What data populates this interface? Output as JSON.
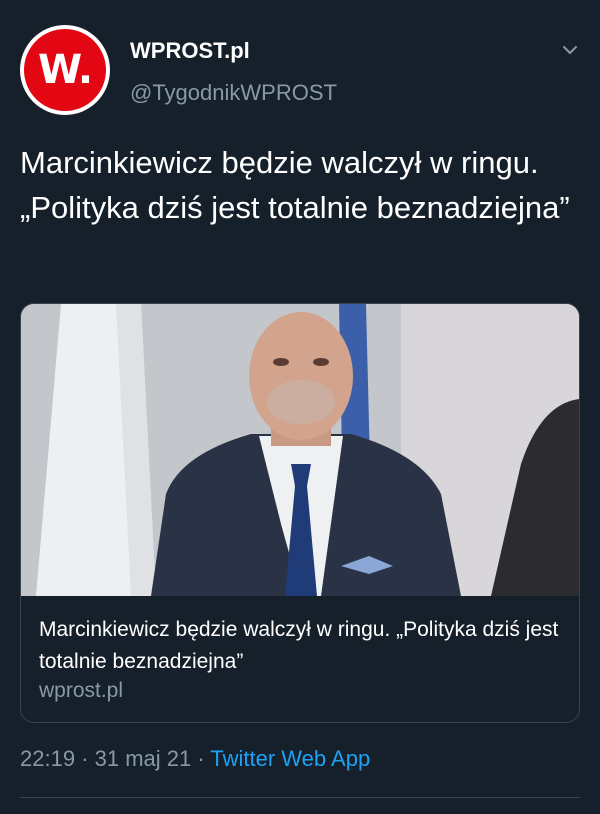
{
  "account": {
    "name": "WPROST.pl",
    "handle": "@TygodnikWPROST",
    "avatar_letter": "W."
  },
  "tweet": {
    "text": "Marcinkiewicz będzie walczył w ringu. „Polityka dziś jest totalnie beznadziejna”"
  },
  "card": {
    "title": "Marcinkiewicz będzie walczył w ringu. „Polityka dziś jest totalnie beznadziejna”",
    "domain": "wprost.pl"
  },
  "meta": {
    "time": "22:19",
    "separator": " · ",
    "date": "31 maj 21",
    "app": "Twitter Web App"
  },
  "icons": {
    "menu": "chevron-down-icon"
  },
  "colors": {
    "background": "#15202b",
    "secondary_text": "#8899a6",
    "link": "#1da1f2",
    "brand_red": "#e30613"
  }
}
